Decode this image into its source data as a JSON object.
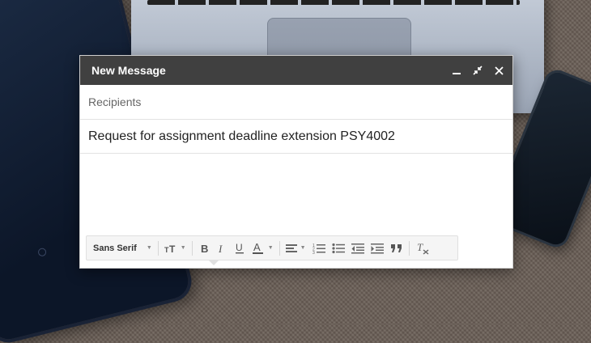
{
  "compose": {
    "title": "New Message",
    "recipients_placeholder": "Recipients",
    "subject": "Request for assignment deadline extension PSY4002"
  },
  "toolbar": {
    "font_family": "Sans Serif",
    "icons": [
      "font-size-icon",
      "bold-icon",
      "italic-icon",
      "underline-icon",
      "text-color-icon",
      "align-icon",
      "numbered-list-icon",
      "bulleted-list-icon",
      "indent-less-icon",
      "indent-more-icon",
      "quote-icon",
      "remove-formatting-icon"
    ]
  },
  "window_controls": [
    "minimize-icon",
    "exit-fullscreen-icon",
    "close-icon"
  ]
}
